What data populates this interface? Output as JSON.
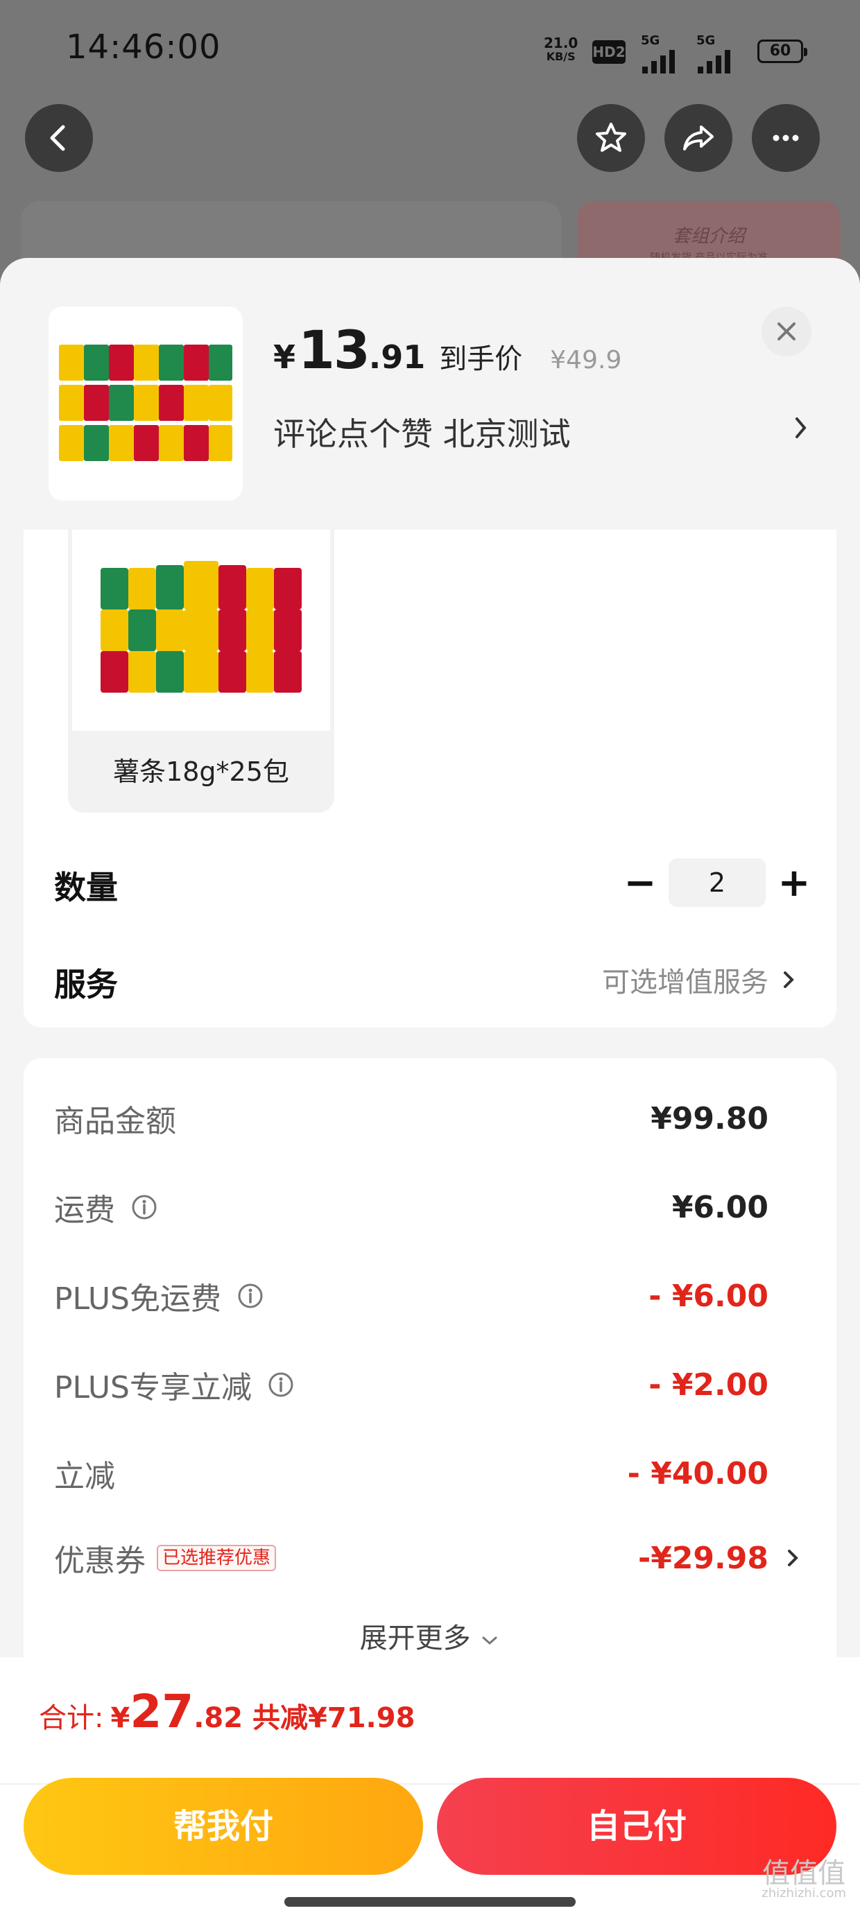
{
  "status_bar": {
    "time": "14:46:00",
    "net_speed": "21.0",
    "net_unit": "KB/S",
    "hd": "HD2",
    "signal1": "5G",
    "signal2": "5G",
    "battery": "60"
  },
  "background": {
    "card_title": "套组介绍",
    "card_subtitle": "随机发货,产品以实际为准"
  },
  "product": {
    "price_currency": "¥",
    "price_int": "13",
    "price_dec": ".91",
    "price_tag": "到手价",
    "original_price": "¥49.9",
    "spec_summary": "评论点个赞  北京测试"
  },
  "variant": {
    "label": "薯条18g*25包"
  },
  "quantity": {
    "label": "数量",
    "value": "2",
    "minus": "−",
    "plus": "+"
  },
  "service": {
    "label": "服务",
    "value": "可选增值服务"
  },
  "fees": [
    {
      "label": "商品金额",
      "value": "¥99.80"
    },
    {
      "label": "运费",
      "value": "¥6.00"
    },
    {
      "label": "PLUS免运费",
      "value": "- ¥6.00"
    },
    {
      "label": "PLUS专享立减",
      "value": "- ¥2.00"
    },
    {
      "label": "立减",
      "value": "- ¥40.00"
    },
    {
      "label": "优惠券",
      "value": "-¥29.98",
      "badge": "已选推荐优惠"
    }
  ],
  "expand_more": "展开更多",
  "total": {
    "label": "合计:",
    "currency": "¥",
    "int": "27",
    "dec": ".82",
    "saved": "共减¥71.98"
  },
  "buttons": {
    "pay_for_me": "帮我付",
    "pay_self": "自己付"
  },
  "watermark": {
    "main": "值值值",
    "sub": "zhizhizhi.com"
  },
  "colors": {
    "price_red": "#e1251b",
    "pay_help_yellow": "#ffb612",
    "pay_self_red": "#f5404f"
  }
}
